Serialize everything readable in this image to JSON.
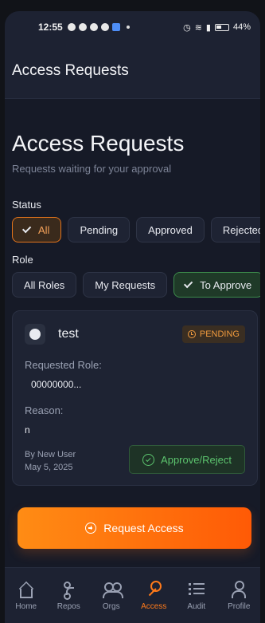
{
  "statusbar": {
    "time": "12:55",
    "battery": "44%"
  },
  "appbar": {
    "title": "Access Requests"
  },
  "page": {
    "title": "Access Requests",
    "subtitle": "Requests waiting for your approval"
  },
  "filters": {
    "status_label": "Status",
    "status_options": [
      "All",
      "Pending",
      "Approved",
      "Rejected"
    ],
    "status_selected": "All",
    "role_label": "Role",
    "role_options": [
      "All Roles",
      "My Requests",
      "To Approve"
    ],
    "role_selected": "To Approve"
  },
  "request": {
    "name": "test",
    "status": "PENDING",
    "requested_role_label": "Requested Role:",
    "requested_role": "00000000...",
    "reason_label": "Reason:",
    "reason": "n",
    "by": "By New User",
    "date": "May 5, 2025",
    "action_label": "Approve/Reject"
  },
  "cta": {
    "label": "Request Access"
  },
  "nav": {
    "items": [
      {
        "label": "Home",
        "icon": "home-icon"
      },
      {
        "label": "Repos",
        "icon": "branch-icon"
      },
      {
        "label": "Orgs",
        "icon": "people-icon"
      },
      {
        "label": "Access",
        "icon": "key-icon"
      },
      {
        "label": "Audit",
        "icon": "list-icon"
      },
      {
        "label": "Profile",
        "icon": "user-icon"
      }
    ],
    "active": "Access"
  },
  "colors": {
    "accent": "#ff7a1a",
    "success": "#5cc46e",
    "background": "#161a27"
  }
}
